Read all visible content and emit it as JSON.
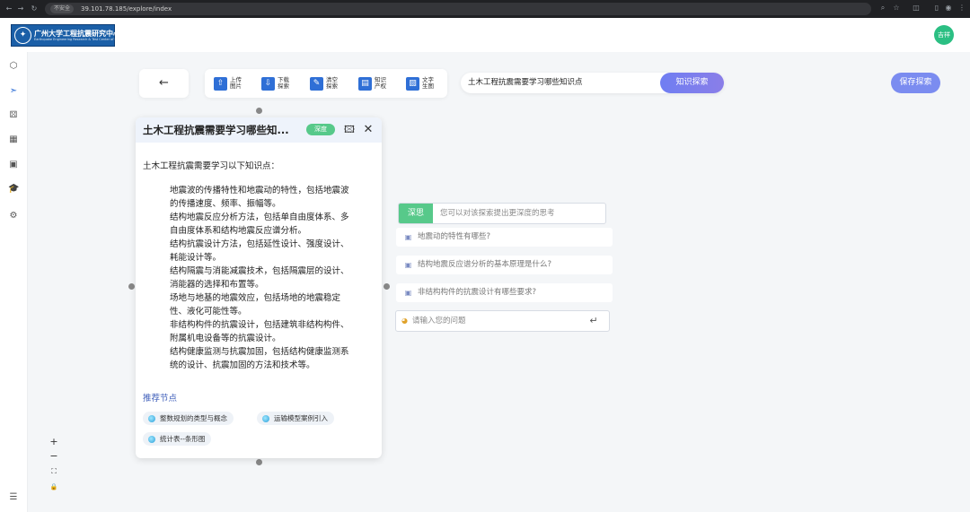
{
  "browser": {
    "security_label": "不安全",
    "url": "39.101.78.185/explore/index"
  },
  "header": {
    "logo_title": "广州大学工程抗震研究中心",
    "logo_subtitle": "Earthquake Engineering Research & Test Center of Guangzhou University",
    "avatar_text": "吉祥"
  },
  "toolbar": {
    "back_glyph": "←",
    "tools": [
      {
        "label": "上传图片",
        "icon": "upload-image-icon",
        "glyph": "⇧"
      },
      {
        "label": "下载探索",
        "icon": "download-icon",
        "glyph": "⇩"
      },
      {
        "label": "清空探索",
        "icon": "clear-icon",
        "glyph": "✎"
      },
      {
        "label": "知识产权",
        "icon": "document-icon",
        "glyph": "▤"
      },
      {
        "label": "文字生图",
        "icon": "text-to-image-icon",
        "glyph": "▨"
      }
    ],
    "search_value": "土木工程抗震需要学习哪些知识点",
    "search_button": "知识探索",
    "save_button": "保存探索"
  },
  "card": {
    "title": "土木工程抗震需要学习哪些知...",
    "tag": "深度",
    "intro": "土木工程抗震需要学习以下知识点：",
    "points": [
      "地震波的传播特性和地震动的特性，包括地震波",
      "的传播速度、频率、振幅等。",
      "结构地震反应分析方法，包括单自由度体系、多",
      "自由度体系和结构地震反应谱分析。",
      "结构抗震设计方法，包括延性设计、强度设计、",
      "耗能设计等。",
      "结构隔震与消能减震技术，包括隔震层的设计、",
      "消能器的选择和布置等。",
      "场地与地基的地震效应，包括场地的地震稳定",
      "性、液化可能性等。",
      "非结构构件的抗震设计，包括建筑非结构构件、",
      "附属机电设备等的抗震设计。",
      "结构健康监测与抗震加固，包括结构健康监测系",
      "统的设计、抗震加固的方法和技术等。"
    ],
    "recommend_title": "推荐节点",
    "recommend": [
      "整数规划的类型与概念",
      "运输模型案例引入",
      "统计表--条形图"
    ]
  },
  "deep": {
    "tag": "深思",
    "hint": "您可以对该探索提出更深度的思考",
    "questions": [
      "地震动的特性有哪些?",
      "结构地震反应谱分析的基本原理是什么?",
      "非结构构件的抗震设计有哪些要求?"
    ],
    "ask_placeholder": "请输入您的问题"
  },
  "zoom": {
    "in": "+",
    "out": "−",
    "fit": "⛶",
    "lock": "🔒"
  }
}
